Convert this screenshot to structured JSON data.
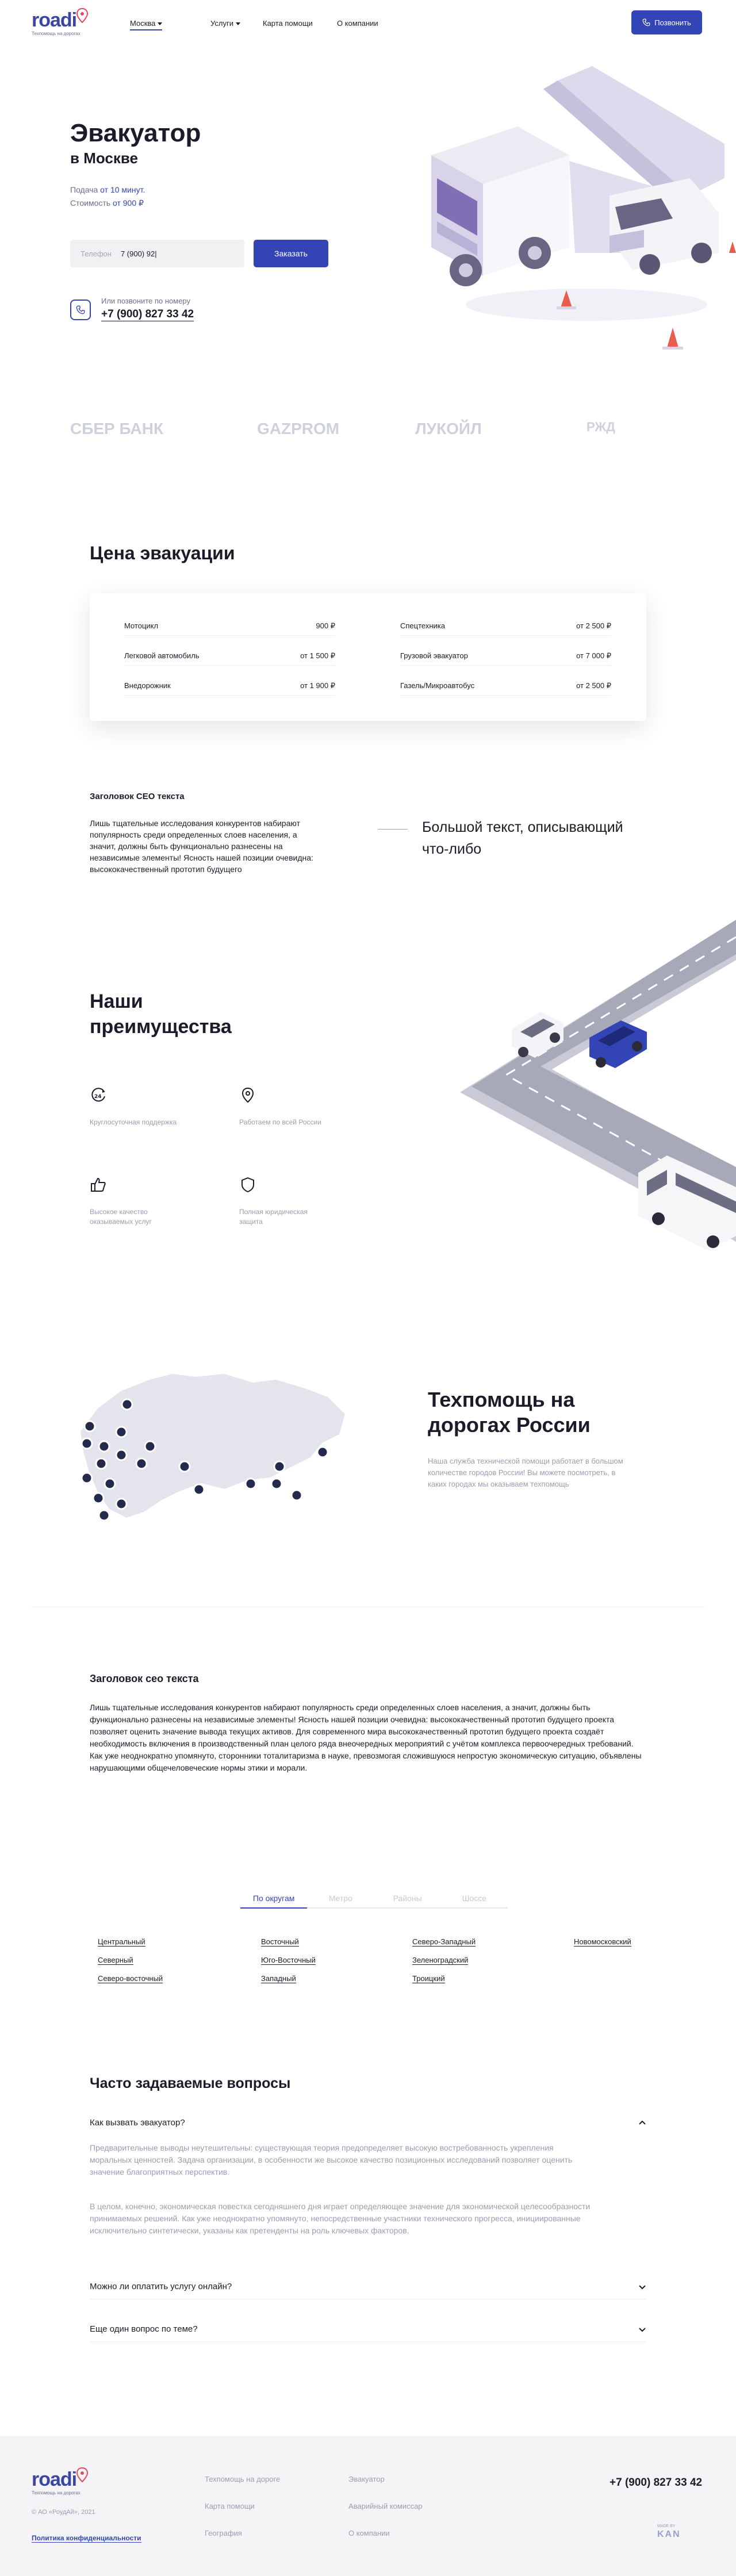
{
  "header": {
    "logo_text": "roadi",
    "logo_sub": "Техпомощь на дорогах",
    "city": "Москва",
    "nav": [
      "Услуги",
      "Карта помощи",
      "О компании"
    ],
    "call_button": "Позвонить",
    "brand_color": "#3345b4"
  },
  "hero": {
    "title": "Эвакуатор",
    "city": "в Москве",
    "delivery_label": "Подача",
    "delivery_value": "от 10 минут.",
    "cost_label": "Стоимость",
    "cost_value": "от 900 ₽",
    "phone_placeholder": "Телефон",
    "phone_value": "7 (900) 92|",
    "order_button": "Заказать",
    "call_hint": "Или позвоните по номеру",
    "call_number": "+7 (900) 827 33 42"
  },
  "partners": [
    "СБЕР БАНК",
    "GAZPROM",
    "ЛУКОЙЛ",
    "РЖД"
  ],
  "prices": {
    "title": "Цена эвакуации",
    "left": [
      {
        "name": "Мотоцикл",
        "price": "900 ₽"
      },
      {
        "name": "Легковой автомобиль",
        "price": "от 1 500 ₽"
      },
      {
        "name": "Внедорожник",
        "price": "от 1 900 ₽"
      }
    ],
    "right": [
      {
        "name": "Спецтехника",
        "price": "от 2 500 ₽"
      },
      {
        "name": "Грузовой эвакуатор",
        "price": "от 7 000 ₽"
      },
      {
        "name": "Газель/Микроавтобус",
        "price": "от 2 500 ₽"
      }
    ]
  },
  "seo1": {
    "title": "Заголовок СЕО текста",
    "text": "Лишь тщательные исследования конкурентов набирают популярность среди определенных слоев населения, а значит, должны быть функционально разнесены на независимые элементы! Ясность нашей позиции очевидна: высококачественный прототип будущего",
    "big_text": "Большой текст, описывающий что-либо"
  },
  "advantages": {
    "title": "Наши преимущества",
    "items": [
      {
        "icon": "clock-24-icon",
        "text": "Круглосуточная поддержка"
      },
      {
        "icon": "location-pin-icon",
        "text": "Работаем по всей России"
      },
      {
        "icon": "thumbs-up-icon",
        "text": "Высокое качество оказываемых услуг"
      },
      {
        "icon": "shield-icon",
        "text": "Полная юридическая защита"
      }
    ]
  },
  "techhelp": {
    "title": "Техпомощь на дорогах России",
    "text": "Наша служба технической помощи работает в большом количестве городов России! Вы можете посмотреть, в каких городах мы оказываем техпомощь"
  },
  "seo2": {
    "title": "Заголовок сео текста",
    "text": "Лишь тщательные исследования конкурентов набирают популярность среди определенных слоев населения, а значит, должны быть функционально разнесены на независимые элементы! Ясность нашей позиции очевидна: высококачественный прототип будущего проекта позволяет оценить значение вывода текущих активов. Для современного мира высококачественный прототип будущего проекта создаёт необходимость включения в производственный план целого ряда внеочередных мероприятий с учётом комплекса первоочередных требований. Как уже неоднократно упомянуто, сторонники тоталитаризма в науке, превозмогая сложившуюся непростую экономическую ситуацию, объявлены нарушающими общечеловеческие нормы этики и морали."
  },
  "districts": {
    "tabs": [
      "По округам",
      "Метро",
      "Районы",
      "Шоссе"
    ],
    "columns": [
      [
        "Центральный",
        "Северный",
        "Северо-восточный"
      ],
      [
        "Восточный",
        "Юго-Восточный",
        "Западный"
      ],
      [
        "Северо-Западный",
        "Зеленоградский",
        "Троицкий"
      ],
      [
        "Новомосковский"
      ]
    ]
  },
  "faq": {
    "title": "Часто задаваемые вопросы",
    "items": [
      {
        "q": "Как вызвать эвакуатор?",
        "a1": "Предварительные выводы неутешительны: существующая теория предопределяет высокую востребованность укрепления моральных ценностей. Задача организации, в особенности же высокое качество позиционных исследований позволяет оценить значение благоприятных перспектив.",
        "a2": "В целом, конечно, экономическая повестка сегодняшнего дня играет определяющее значение для экономической целесообразности принимаемых решений. Как уже неоднократно упомянуто, непосредственные участники технического прогресса, инициированные исключительно синтетически, указаны как претенденты на роль ключевых факторов."
      },
      {
        "q": "Можно ли оплатить услугу онлайн?"
      },
      {
        "q": "Еще один вопрос по теме?"
      }
    ]
  },
  "footer": {
    "links_col1": [
      "Техпомощь на дороге",
      "Карта помощи",
      "География"
    ],
    "links_col2": [
      "Эвакуатор",
      "Аварийный комиссар",
      "О компании"
    ],
    "phone": "+7 (900) 827 33 42",
    "copyright": "© АО «РоудАй», 2021",
    "privacy": "Политика конфиденциальности",
    "made_by": "MADE BY",
    "made_by_logo": "KAN"
  }
}
